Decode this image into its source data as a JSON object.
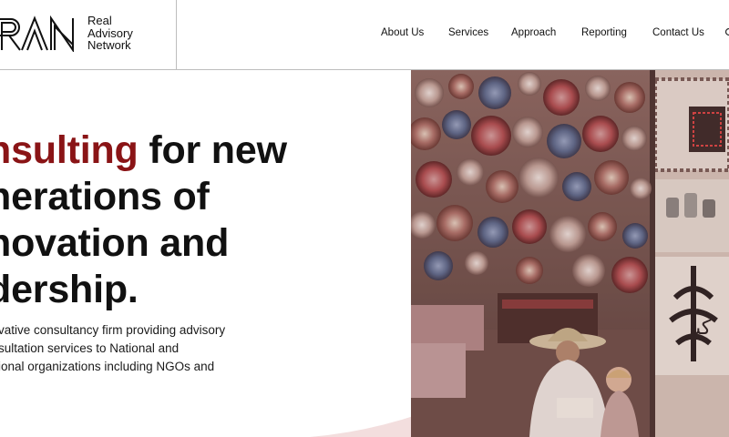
{
  "brand": {
    "line1": "Real",
    "line2": "Advisory",
    "line3": "Network",
    "accent_color": "#8a1416"
  },
  "nav": {
    "items": [
      {
        "label": "About Us"
      },
      {
        "label": "Services"
      },
      {
        "label": "Approach"
      },
      {
        "label": "Reporting"
      },
      {
        "label": "Contact Us"
      }
    ]
  },
  "hero": {
    "headline_accent": "nsulting",
    "headline_rest": " for new",
    "headline_line2": "nerations of",
    "headline_line3": "novation and",
    "headline_line4": "dership.",
    "subtext_line1": "vative consultancy firm providing advisory",
    "subtext_line2": "sultation services to National and",
    "subtext_line3": "ional organizations including NGOs and"
  },
  "photo": {
    "wall_text": "كبر"
  }
}
